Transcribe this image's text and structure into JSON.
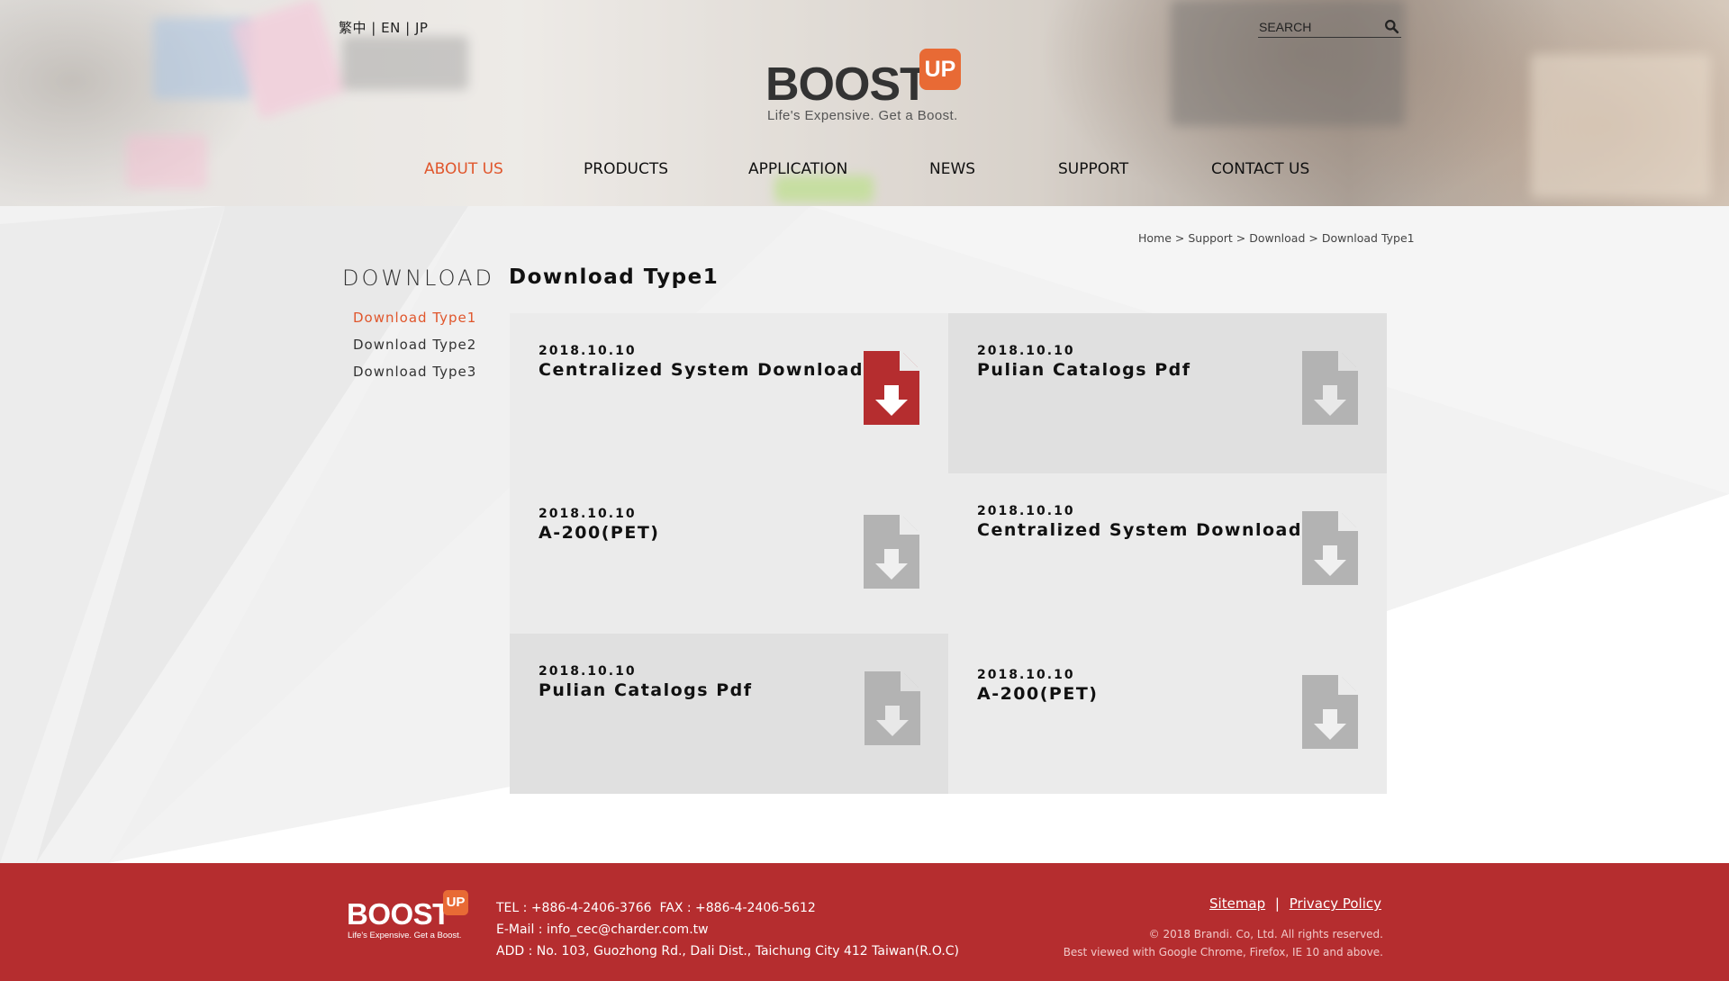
{
  "header": {
    "languages": [
      "繁中",
      "EN",
      "JP"
    ],
    "lang_separator": "|",
    "search_placeholder": "SEARCH",
    "search_icon": "magnifier-icon",
    "logo": {
      "word": "BOOST",
      "badge": "UP",
      "tagline": "Life's Expensive. Get a Boost."
    },
    "nav": [
      "ABOUT US",
      "PRODUCTS",
      "APPLICATION",
      "NEWS",
      "SUPPORT",
      "CONTACT US"
    ],
    "active_nav": "ABOUT US"
  },
  "breadcrumb": {
    "items": [
      "Home",
      "Support",
      "Download",
      "Download Type1"
    ],
    "separator": ">"
  },
  "sidebar": {
    "title": "DOWNLOAD",
    "items": [
      "Download Type1",
      "Download Type2",
      "Download Type3"
    ],
    "active": "Download Type1"
  },
  "main": {
    "title": "Download Type1",
    "cards": [
      {
        "date": "2018.10.10",
        "name": "Centralized System Download",
        "icon": "file-download-icon",
        "highlighted": true
      },
      {
        "date": "2018.10.10",
        "name": "Pulian Catalogs Pdf",
        "icon": "file-download-icon",
        "highlighted": false
      },
      {
        "date": "2018.10.10",
        "name": "A-200(PET)",
        "icon": "file-download-icon",
        "highlighted": false
      },
      {
        "date": "2018.10.10",
        "name": "Centralized System Download",
        "icon": "file-download-icon",
        "highlighted": false
      },
      {
        "date": "2018.10.10",
        "name": "Pulian Catalogs Pdf",
        "icon": "file-download-icon",
        "highlighted": false
      },
      {
        "date": "2018.10.10",
        "name": "A-200(PET)",
        "icon": "file-download-icon",
        "highlighted": false
      }
    ]
  },
  "footer": {
    "logo": {
      "word": "BOOST",
      "badge": "UP",
      "tagline": "Life's Expensive. Get a Boost."
    },
    "tel_fax": "TEL : +886-4-2406-3766  FAX : +886-4-2406-5612",
    "email": "E-Mail : info_cec@charder.com.tw",
    "address": "ADD : No. 103, Guozhong Rd., Dali Dist., Taichung City 412 Taiwan(R.O.C)",
    "links": [
      "Sitemap",
      "Privacy Policy"
    ],
    "link_separator": "|",
    "copyright": "© 2018 Brandi. Co, Ltd. All rights reserved.",
    "browser_note": "Best viewed with Google Chrome, Firefox, IE 10 and above."
  },
  "colors": {
    "accent": "#e0562c",
    "brand_orange": "#e86a35",
    "footer_red": "#b52d2f",
    "icon_active": "#b52d2f",
    "icon_inactive": "#b3b3b3",
    "card_light": "#ebebeb",
    "card_dark": "#e0e0e0"
  }
}
